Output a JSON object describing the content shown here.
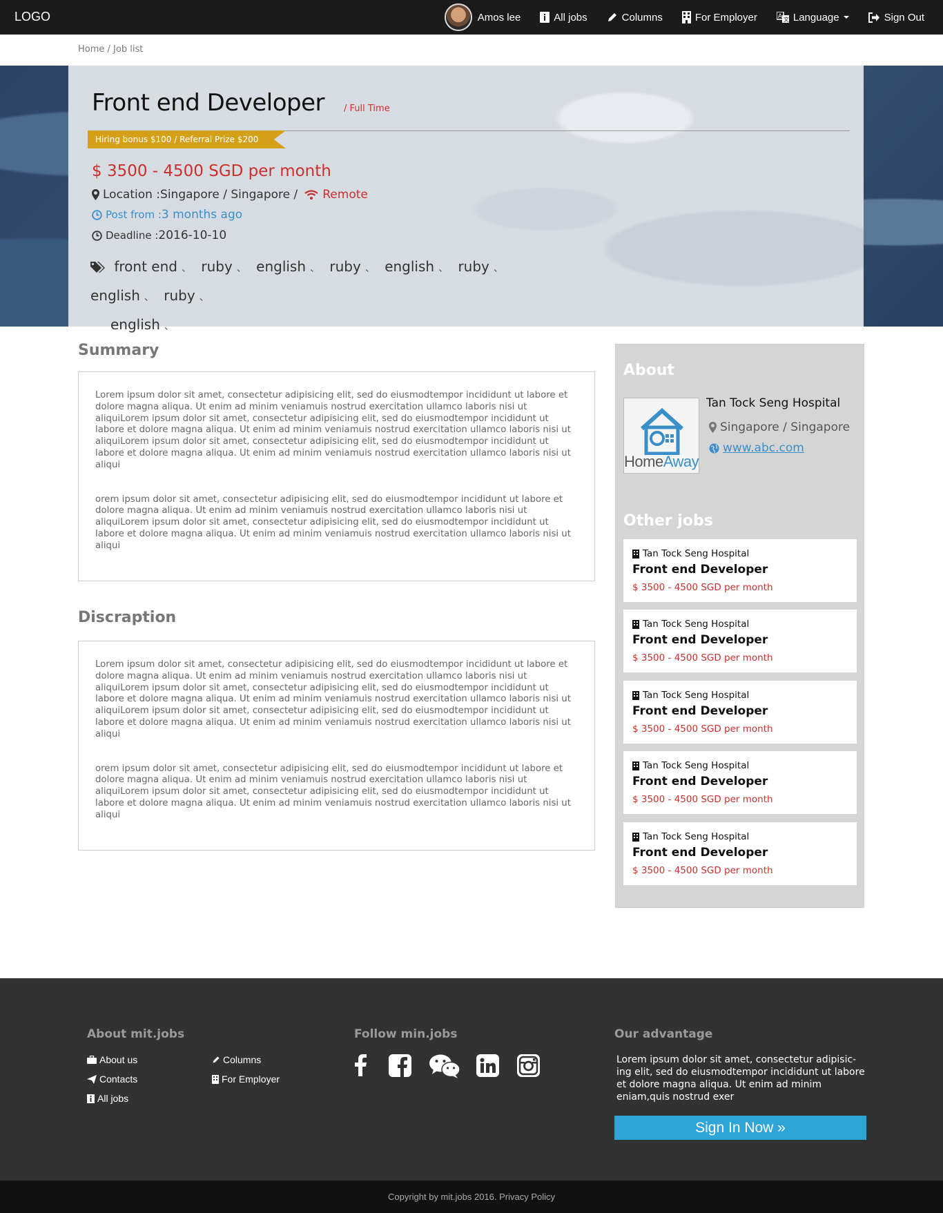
{
  "navbar": {
    "logo": "LOGO",
    "user_name": "Amos lee",
    "items": [
      {
        "label": "All jobs",
        "icon": "info-icon"
      },
      {
        "label": "Columns",
        "icon": "pencil-icon"
      },
      {
        "label": "For Employer",
        "icon": "building-icon"
      },
      {
        "label": "Language",
        "icon": "translate-icon"
      },
      {
        "label": "Sign Out",
        "icon": "sign-out-icon"
      }
    ]
  },
  "breadcrumb": {
    "home": "Home",
    "sep": " / ",
    "current": "Job list"
  },
  "job": {
    "title": "Front end Developer",
    "type": "/ Full Time",
    "ribbon": "Hiring bonus $100 /  Referral Prize $200",
    "salary": "$ 3500 - 4500 SGD per month",
    "location_label": "Location : ",
    "location_value": "Singapore / Singapore /",
    "remote": "Remote",
    "post_label": "Post from : ",
    "post_value": "3 months ago",
    "deadline_label": "Deadline : ",
    "deadline_value": "2016-10-10",
    "tags": [
      "front end",
      "ruby",
      "english",
      "ruby",
      "english",
      "ruby",
      "english",
      "ruby",
      "english"
    ],
    "tag_separator": "、"
  },
  "summary": {
    "heading": "Summary",
    "paragraphs": [
      "Lorem ipsum dolor sit amet, consectetur adipisicing elit, sed do eiusmodtempor incididunt ut labore et dolore magna aliqua. Ut enim ad minim veniamuis nostrud exercitation ullamco laboris nisi ut aliquiLorem ipsum dolor sit amet, consectetur adipisicing elit, sed do eiusmodtempor incididunt ut labore et dolore magna aliqua. Ut enim ad minim veniamuis nostrud exercitation ullamco laboris nisi ut aliquiLorem ipsum dolor sit amet, consectetur adipisicing elit, sed do eiusmodtempor incididunt ut labore et dolore magna aliqua. Ut enim ad minim veniamuis nostrud exercitation ullamco laboris nisi ut aliqui",
      "orem ipsum dolor sit amet, consectetur adipisicing elit, sed do eiusmodtempor incididunt ut labore et dolore magna aliqua. Ut enim ad minim veniamuis nostrud exercitation ullamco laboris nisi ut aliquiLorem ipsum dolor sit amet, consectetur adipisicing elit, sed do eiusmodtempor incididunt ut labore et dolore magna aliqua. Ut enim ad minim veniamuis nostrud exercitation ullamco laboris nisi ut aliqui"
    ]
  },
  "description": {
    "heading": "Discraption",
    "paragraphs": [
      "Lorem ipsum dolor sit amet, consectetur adipisicing elit, sed do eiusmodtempor incididunt ut labore et dolore magna aliqua. Ut enim ad minim veniamuis nostrud exercitation ullamco laboris nisi ut aliquiLorem ipsum dolor sit amet, consectetur adipisicing elit, sed do eiusmodtempor incididunt ut labore et dolore magna aliqua. Ut enim ad minim veniamuis nostrud exercitation ullamco laboris nisi ut aliquiLorem ipsum dolor sit amet, consectetur adipisicing elit, sed do eiusmodtempor incididunt ut labore et dolore magna aliqua. Ut enim ad minim veniamuis nostrud exercitation ullamco laboris nisi ut aliqui",
      "orem ipsum dolor sit amet, consectetur adipisicing elit, sed do eiusmodtempor incididunt ut labore et dolore magna aliqua. Ut enim ad minim veniamuis nostrud exercitation ullamco laboris nisi ut aliquiLorem ipsum dolor sit amet, consectetur adipisicing elit, sed do eiusmodtempor incididunt ut labore et dolore magna aliqua. Ut enim ad minim veniamuis nostrud exercitation ullamco laboris nisi ut aliqui"
    ]
  },
  "about": {
    "heading": "About",
    "logo_text_a": "Home",
    "logo_text_b": "Away",
    "company": "Tan Tock Seng Hospital",
    "location": "Singapore / Singapore",
    "website": "www.abc.com"
  },
  "other_jobs": {
    "heading": "Other jobs",
    "items": [
      {
        "company": "Tan Tock Seng Hospital",
        "title": "Front end Developer",
        "salary": "$ 3500 - 4500 SGD per month"
      },
      {
        "company": "Tan Tock Seng Hospital",
        "title": "Front end Developer",
        "salary": "$ 3500 - 4500 SGD per month"
      },
      {
        "company": "Tan Tock Seng Hospital",
        "title": "Front end Developer",
        "salary": "$ 3500 - 4500 SGD per month"
      },
      {
        "company": "Tan Tock Seng Hospital",
        "title": "Front end Developer",
        "salary": "$ 3500 - 4500 SGD per month"
      },
      {
        "company": "Tan Tock Seng Hospital",
        "title": "Front end Developer",
        "salary": "$ 3500 - 4500 SGD per month"
      }
    ]
  },
  "footer": {
    "about_heading": "About mit.jobs",
    "links": {
      "about_us": "About us",
      "contacts": "Contacts",
      "all_jobs": "All jobs",
      "columns": "Columns",
      "for_employer": "For Employer"
    },
    "follow_heading": "Follow min.jobs",
    "social": [
      "facebook-icon",
      "facebook-square-icon",
      "wechat-icon",
      "linkedin-icon",
      "instagram-icon"
    ],
    "advantage_heading": "Our advantage",
    "advantage_text": "Lorem ipsum dolor sit amet, consectetur adipisic-ing elit, sed do eiusmodtempor incididunt ut labore et dolore magna aliqua. Ut enim ad minim eniam,quis nostrud exer",
    "signin": "Sign In Now »",
    "copyright": "Copyright by mit.jobs 2016. Privacy Policy"
  },
  "colors": {
    "navbar": "#1b1b1b",
    "accent_red": "#c9302c",
    "accent_blue": "#3a8fc9",
    "ribbon": "#d4a017",
    "signin": "#2fa4d6",
    "footer": "#323232"
  }
}
